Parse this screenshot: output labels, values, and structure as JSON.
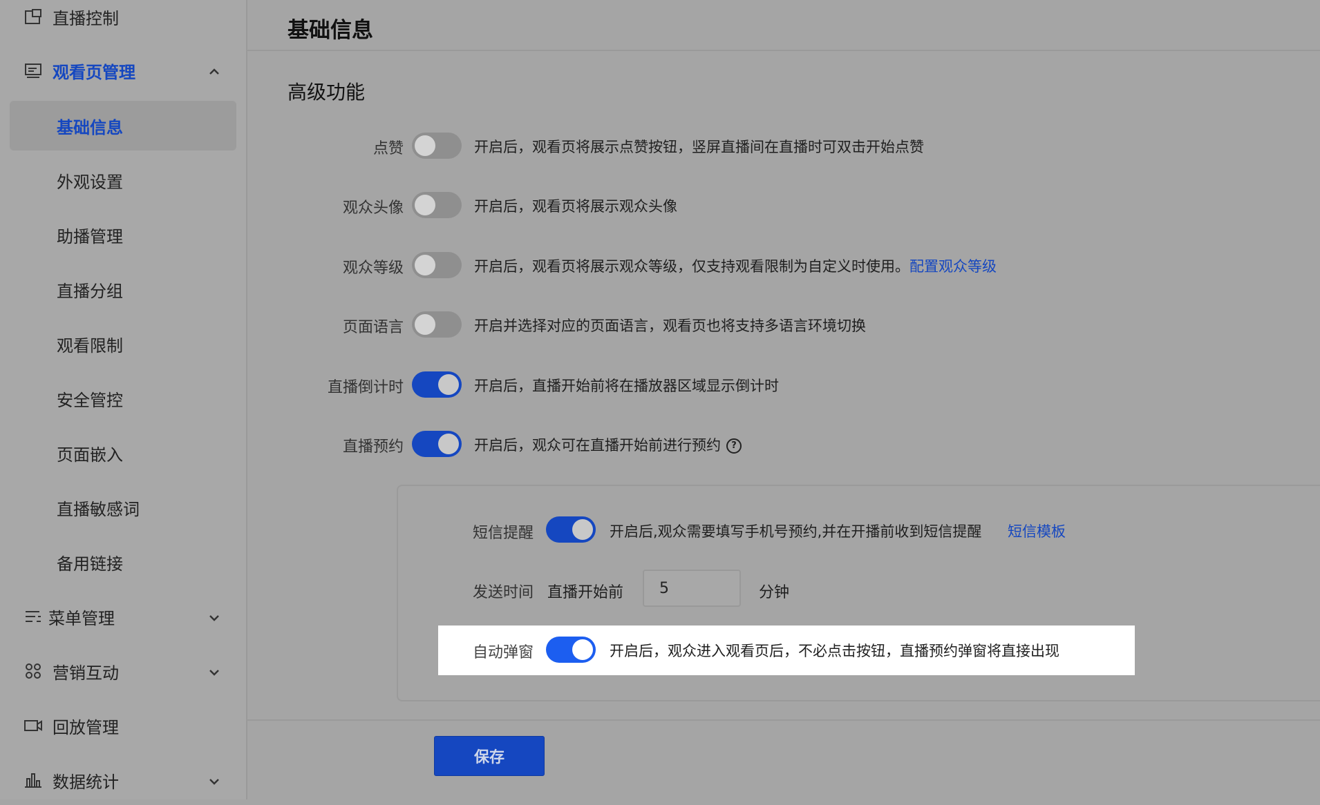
{
  "sidebar": {
    "items": [
      {
        "label": "直播控制",
        "icon": "broadcast-control-icon"
      },
      {
        "label": "观看页管理",
        "icon": "watch-page-icon",
        "expanded": true,
        "children": [
          "基础信息",
          "外观设置",
          "助播管理",
          "直播分组",
          "观看限制",
          "安全管控",
          "页面嵌入",
          "直播敏感词",
          "备用链接"
        ],
        "active_child": "基础信息"
      },
      {
        "label": "菜单管理",
        "icon": "menu-list-icon"
      },
      {
        "label": "营销互动",
        "icon": "marketing-grid-icon"
      },
      {
        "label": "回放管理",
        "icon": "replay-video-icon"
      },
      {
        "label": "数据统计",
        "icon": "bar-chart-icon"
      }
    ]
  },
  "main": {
    "page_title": "基础信息",
    "section_title": "高级功能",
    "features": [
      {
        "label": "点赞",
        "enabled": false,
        "desc": "开启后，观看页将展示点赞按钮，竖屏直播间在直播时可双击开始点赞"
      },
      {
        "label": "观众头像",
        "enabled": false,
        "desc": "开启后，观看页将展示观众头像"
      },
      {
        "label": "观众等级",
        "enabled": false,
        "desc": "开启后，观看页将展示观众等级，仅支持观看限制为自定义时使用。",
        "link": "配置观众等级"
      },
      {
        "label": "页面语言",
        "enabled": false,
        "desc": "开启并选择对应的页面语言，观看页也将支持多语言环境切换"
      },
      {
        "label": "直播倒计时",
        "enabled": true,
        "desc": "开启后，直播开始前将在播放器区域显示倒计时"
      },
      {
        "label": "直播预约",
        "enabled": true,
        "desc": "开启后，观众可在直播开始前进行预约"
      }
    ],
    "reservation": {
      "sms_label": "短信提醒",
      "sms_enabled": true,
      "sms_desc": "开启后,观众需要填写手机号预约,并在开播前收到短信提醒",
      "sms_link": "短信模板",
      "send_time_label": "发送时间",
      "send_time_prefix": "直播开始前",
      "send_time_value": "5",
      "send_time_unit": "分钟",
      "popup_label": "自动弹窗",
      "popup_enabled": true,
      "popup_desc": "开启后，观众进入观看页后，不必点击按钮，直播预约弹窗将直接出现"
    },
    "save_label": "保存"
  },
  "colors": {
    "accent": "#1547c0",
    "accent_bright": "#1c5ef0",
    "overlay": "#a5a5a5"
  }
}
